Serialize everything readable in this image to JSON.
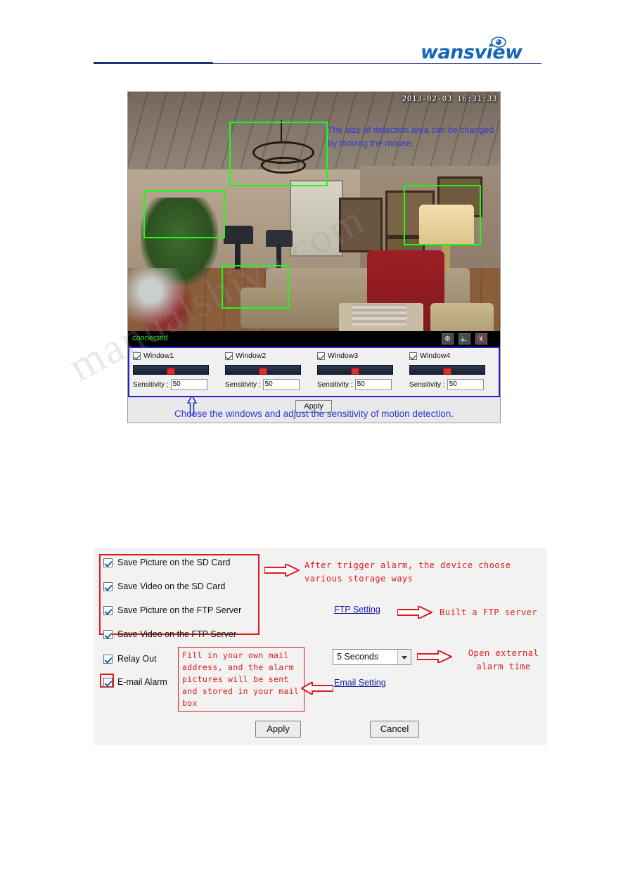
{
  "header": {
    "logo_text": "wansview",
    "logo_icon": "camera-eye-icon"
  },
  "figure1": {
    "timestamp": "2013-02-03  16:31:33",
    "overlay_note": "The size of detection area can be changed by moving the mouse.",
    "status": "connected",
    "status_buttons": [
      {
        "name": "settings-icon",
        "glyph": "⚒"
      },
      {
        "name": "mic-mute-icon",
        "glyph": "Ἲ4"
      },
      {
        "name": "speaker-mute-icon",
        "glyph": "◀×"
      }
    ],
    "detection_windows": [
      {
        "label": "Window1",
        "checked": true,
        "sensitivity_label": "Sensitivity :",
        "sensitivity": "50"
      },
      {
        "label": "Window2",
        "checked": true,
        "sensitivity_label": "Sensitivity :",
        "sensitivity": "50"
      },
      {
        "label": "Window3",
        "checked": true,
        "sensitivity_label": "Sensitivity :",
        "sensitivity": "50"
      },
      {
        "label": "Window4",
        "checked": true,
        "sensitivity_label": "Sensitivity :",
        "sensitivity": "50"
      }
    ],
    "apply_label": "Apply",
    "caption": "Choose the windows and adjust the sensitivity of motion detection."
  },
  "watermark": "manualshive.com",
  "figure2": {
    "options": [
      {
        "label": "Save Picture on the SD Card",
        "checked": true
      },
      {
        "label": "Save Video on the SD Card",
        "checked": true
      },
      {
        "label": "Save Picture on the FTP Server",
        "checked": true
      },
      {
        "label": "Save Video on the FTP Server",
        "checked": true
      },
      {
        "label": "Relay Out",
        "checked": true
      },
      {
        "label": "E-mail Alarm",
        "checked": true
      }
    ],
    "annotation_storage": "After trigger alarm, the device choose various storage ways",
    "annotation_ftp": "Built a FTP server",
    "annotation_time": "Open external alarm time",
    "note_email": "Fill in your own mail address, and the alarm pictures will be sent and stored in your mail box",
    "ftp_setting_link": "FTP Setting",
    "email_setting_link": "Email Setting",
    "time_select_value": "5 Seconds",
    "apply_label": "Apply",
    "cancel_label": "Cancel"
  }
}
